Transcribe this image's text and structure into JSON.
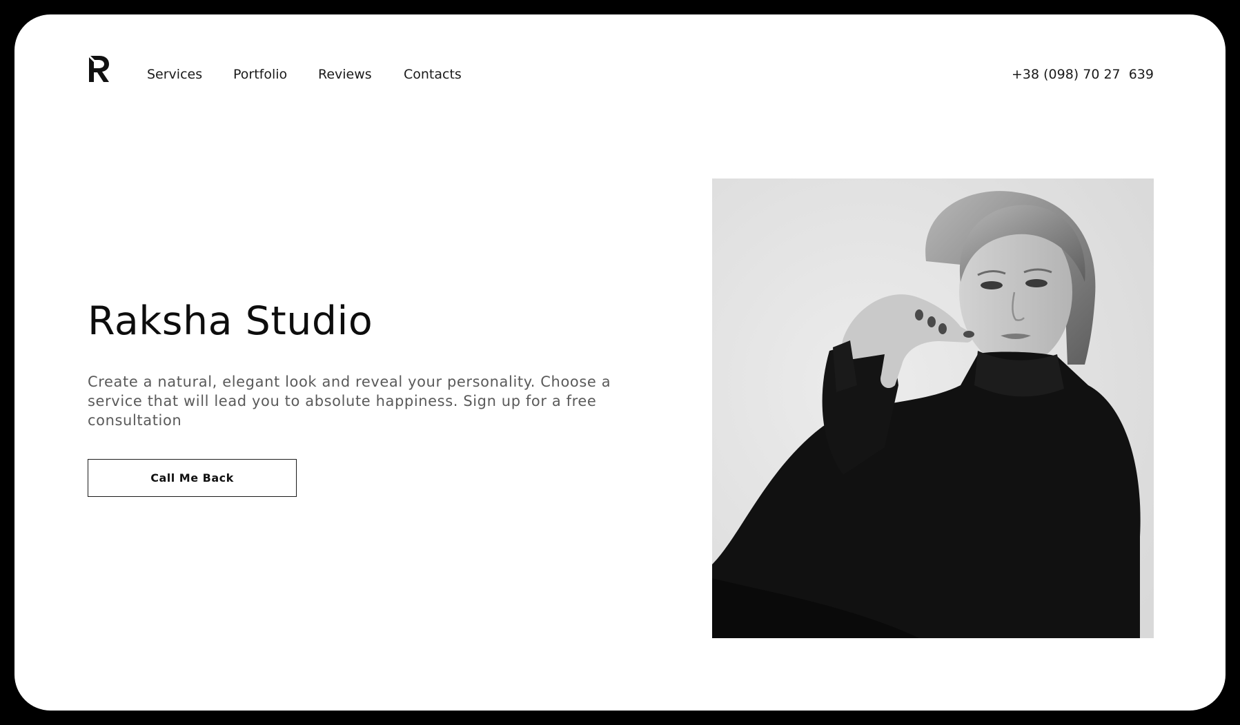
{
  "header": {
    "logo_text": "R",
    "nav": [
      {
        "label": "Services"
      },
      {
        "label": "Portfolio"
      },
      {
        "label": "Reviews"
      },
      {
        "label": "Contacts"
      }
    ],
    "phone": "+38 (098) 70 27  639"
  },
  "hero": {
    "title": "Raksha Studio",
    "description": "Create a natural, elegant look and reveal your personality. Choose a service that will lead you to absolute happiness. Sign up for a free consultation",
    "cta_label": "Call Me Back"
  },
  "photo": {
    "icon": "portrait-photo"
  },
  "colors": {
    "frame": "#000000",
    "page_background": "#ffffff",
    "text_primary": "#0d0d0d",
    "text_secondary": "#5a5a5a"
  }
}
